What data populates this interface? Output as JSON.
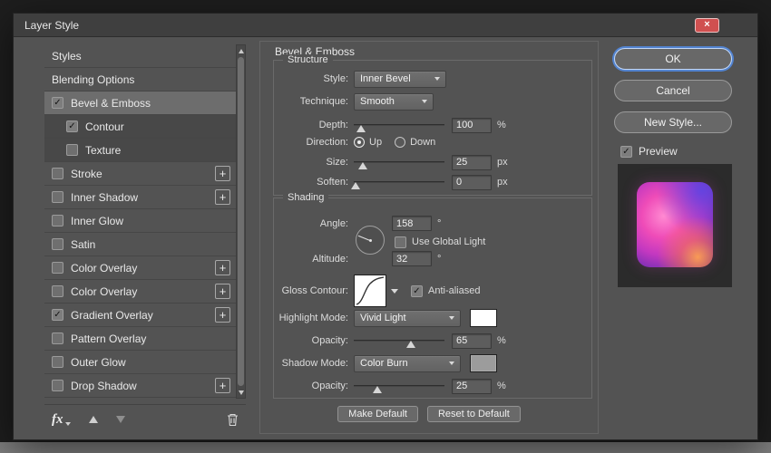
{
  "window": {
    "title": "Layer Style"
  },
  "colors": {
    "accent_focus": "#528ce6",
    "highlight_swatch": "#ffffff",
    "shadow_swatch": "#9c9c9c",
    "preview_gradient": [
      "#ff8ad2",
      "#ef4cb8",
      "#c338c0",
      "#7c2fb4",
      "#4b2688",
      "#ff9850"
    ]
  },
  "sidebar": {
    "items": [
      {
        "label": "Styles",
        "checkbox": false,
        "checked": false,
        "selected": false,
        "indent": false,
        "plus": false
      },
      {
        "label": "Blending Options",
        "checkbox": false,
        "checked": false,
        "selected": false,
        "indent": false,
        "plus": false
      },
      {
        "label": "Bevel & Emboss",
        "checkbox": true,
        "checked": true,
        "selected": true,
        "indent": false,
        "plus": false
      },
      {
        "label": "Contour",
        "checkbox": true,
        "checked": true,
        "selected": false,
        "indent": true,
        "plus": false
      },
      {
        "label": "Texture",
        "checkbox": true,
        "checked": false,
        "selected": false,
        "indent": true,
        "plus": false
      },
      {
        "label": "Stroke",
        "checkbox": true,
        "checked": false,
        "selected": false,
        "indent": false,
        "plus": true
      },
      {
        "label": "Inner Shadow",
        "checkbox": true,
        "checked": false,
        "selected": false,
        "indent": false,
        "plus": true
      },
      {
        "label": "Inner Glow",
        "checkbox": true,
        "checked": false,
        "selected": false,
        "indent": false,
        "plus": false
      },
      {
        "label": "Satin",
        "checkbox": true,
        "checked": false,
        "selected": false,
        "indent": false,
        "plus": false
      },
      {
        "label": "Color Overlay",
        "checkbox": true,
        "checked": false,
        "selected": false,
        "indent": false,
        "plus": true
      },
      {
        "label": "Color Overlay",
        "checkbox": true,
        "checked": false,
        "selected": false,
        "indent": false,
        "plus": true
      },
      {
        "label": "Gradient Overlay",
        "checkbox": true,
        "checked": true,
        "selected": false,
        "indent": false,
        "plus": true
      },
      {
        "label": "Pattern Overlay",
        "checkbox": true,
        "checked": false,
        "selected": false,
        "indent": false,
        "plus": false
      },
      {
        "label": "Outer Glow",
        "checkbox": true,
        "checked": false,
        "selected": false,
        "indent": false,
        "plus": false
      },
      {
        "label": "Drop Shadow",
        "checkbox": true,
        "checked": false,
        "selected": false,
        "indent": false,
        "plus": true
      }
    ],
    "footer": {
      "fx_label": "fx"
    }
  },
  "panel": {
    "title": "Bevel & Emboss",
    "structure": {
      "title": "Structure",
      "style": {
        "label": "Style:",
        "value": "Inner Bevel"
      },
      "technique": {
        "label": "Technique:",
        "value": "Smooth"
      },
      "depth": {
        "label": "Depth:",
        "value": "100",
        "unit": "%",
        "percent": 8
      },
      "direction": {
        "label": "Direction:",
        "options": [
          "Up",
          "Down"
        ],
        "selected": "Up"
      },
      "size": {
        "label": "Size:",
        "value": "25",
        "unit": "px",
        "percent": 10
      },
      "soften": {
        "label": "Soften:",
        "value": "0",
        "unit": "px",
        "percent": 2
      }
    },
    "shading": {
      "title": "Shading",
      "angle": {
        "label": "Angle:",
        "value": "158",
        "unit": "°"
      },
      "use_global_light": {
        "label": "Use Global Light",
        "checked": false
      },
      "altitude": {
        "label": "Altitude:",
        "value": "32",
        "unit": "°"
      },
      "gloss_contour": {
        "label": "Gloss Contour:"
      },
      "anti_aliased": {
        "label": "Anti-aliased",
        "checked": true
      },
      "highlight_mode": {
        "label": "Highlight Mode:",
        "value": "Vivid Light"
      },
      "highlight_opacity": {
        "label": "Opacity:",
        "value": "65",
        "unit": "%",
        "percent": 63
      },
      "shadow_mode": {
        "label": "Shadow Mode:",
        "value": "Color Burn"
      },
      "shadow_opacity": {
        "label": "Opacity:",
        "value": "25",
        "unit": "%",
        "percent": 26
      }
    },
    "buttons": {
      "make_default": "Make Default",
      "reset_to_default": "Reset to Default"
    }
  },
  "actions": {
    "ok": "OK",
    "cancel": "Cancel",
    "new_style": "New Style...",
    "preview": {
      "label": "Preview",
      "checked": true
    }
  }
}
